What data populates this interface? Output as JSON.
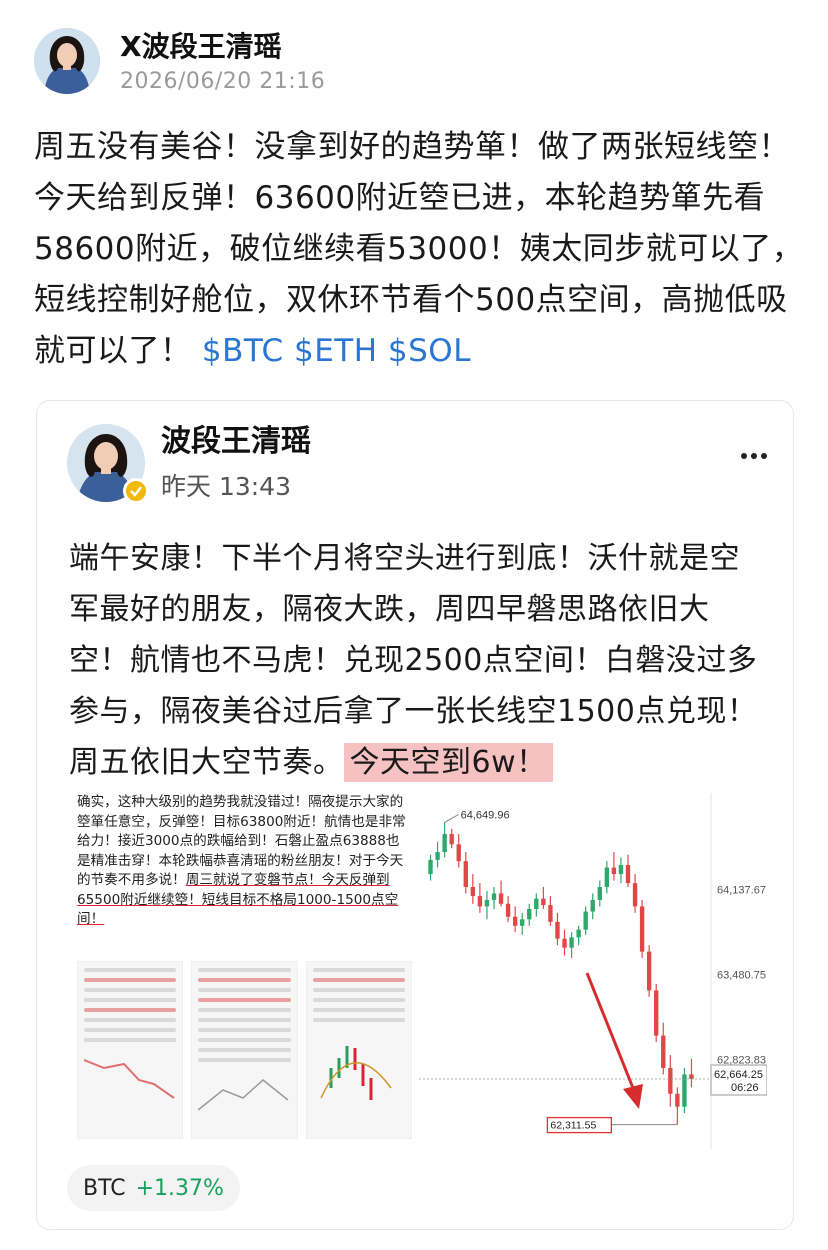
{
  "post": {
    "author": "X波段王清瑶",
    "timestamp": "2026/06/20 21:16",
    "text": "周五没有美谷！没拿到好的趋势箪！做了两张短线箜！今天给到反弹！63600附近箜已进，本轮趋势箪先看58600附近，破位继续看53000！姨太同步就可以了，短线控制好舱位，双休环节看个500点空间，高抛低吸就可以了！",
    "cashtags": [
      "$BTC",
      "$ETH",
      "$SOL"
    ]
  },
  "quote": {
    "author": "波段王清瑶",
    "time": "昨天 13:43",
    "text": "端午安康！下半个月将空头进行到底！沃什就是空军最好的朋友，隔夜大跌，周四早磐思路依旧大空！航情也不马虎！兑现2500点空间！白磐没过多参与，隔夜美谷过后拿了一张长线空1500点兑现！周五依旧大空节奏。",
    "highlight": "今天空到6w！",
    "image_text_plain": "确实，这种大级别的趋势我就没错过！隔夜提示大家的箜箪任意空，反弹箜！目标63800附近！航情也是非常给力！接近3000点的跌幅给到！石磐止盈点63888也是精准击穿！本轮跌幅恭喜清瑶的粉丝朋友！对于今天的节奏不用多说！",
    "image_text_underlined": "周三就说了变磐节点！今天反弹到65500附近继续箜！短线目标不格局1000-1500点空间！"
  },
  "ticker": {
    "symbol": "BTC",
    "change": "+1.37%",
    "color": "#18a15f"
  },
  "chart_data": {
    "type": "candlestick",
    "price_labels": [
      "64,649.96",
      "64,137.67",
      "63,480.75",
      "62,823.83",
      "62,664.25",
      "62,311.55"
    ],
    "countdown": "06:26",
    "high": 64649.96,
    "low": 62311.55,
    "last": 62664.25,
    "ylim": [
      62200,
      64800
    ],
    "candles": [
      [
        64250,
        64400,
        64200,
        64360
      ],
      [
        64360,
        64500,
        64300,
        64420
      ],
      [
        64420,
        64650,
        64380,
        64560
      ],
      [
        64560,
        64600,
        64450,
        64480
      ],
      [
        64480,
        64560,
        64300,
        64350
      ],
      [
        64350,
        64420,
        64100,
        64150
      ],
      [
        64150,
        64250,
        64020,
        64080
      ],
      [
        64080,
        64180,
        63950,
        64000
      ],
      [
        64000,
        64120,
        63900,
        64050
      ],
      [
        64050,
        64150,
        63980,
        64100
      ],
      [
        64100,
        64200,
        64000,
        64020
      ],
      [
        64020,
        64080,
        63880,
        63920
      ],
      [
        63920,
        64000,
        63800,
        63850
      ],
      [
        63850,
        63950,
        63780,
        63900
      ],
      [
        63900,
        64020,
        63850,
        63980
      ],
      [
        63980,
        64100,
        63920,
        64060
      ],
      [
        64060,
        64150,
        63980,
        64010
      ],
      [
        64010,
        64080,
        63850,
        63880
      ],
      [
        63880,
        63950,
        63700,
        63750
      ],
      [
        63750,
        63820,
        63620,
        63680
      ],
      [
        63680,
        63800,
        63600,
        63760
      ],
      [
        63760,
        63850,
        63700,
        63820
      ],
      [
        63820,
        64000,
        63780,
        63960
      ],
      [
        63960,
        64100,
        63900,
        64050
      ],
      [
        64050,
        64200,
        64000,
        64150
      ],
      [
        64150,
        64350,
        64100,
        64300
      ],
      [
        64300,
        64420,
        64200,
        64250
      ],
      [
        64250,
        64380,
        64180,
        64320
      ],
      [
        64320,
        64400,
        64150,
        64180
      ],
      [
        64180,
        64250,
        63950,
        64000
      ],
      [
        64000,
        64050,
        63600,
        63650
      ],
      [
        63650,
        63700,
        63300,
        63350
      ],
      [
        63350,
        63400,
        62950,
        63000
      ],
      [
        63000,
        63100,
        62700,
        62750
      ],
      [
        62750,
        62850,
        62450,
        62550
      ],
      [
        62550,
        62600,
        62311,
        62450
      ],
      [
        62450,
        62750,
        62400,
        62700
      ],
      [
        62700,
        62820,
        62600,
        62664
      ]
    ]
  }
}
